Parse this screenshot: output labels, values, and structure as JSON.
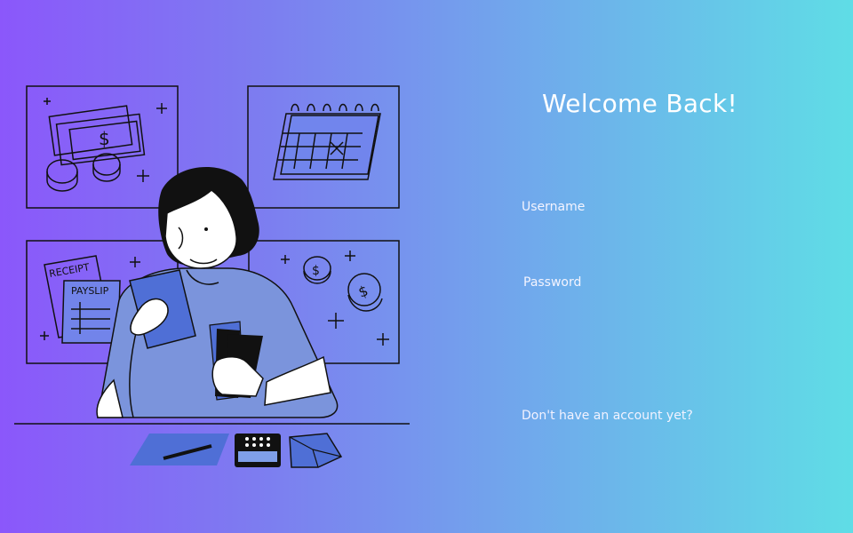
{
  "login": {
    "title": "Welcome Back!",
    "username_label": "Username",
    "username_value": "",
    "password_label": "Password",
    "password_value": "",
    "signup_link": "Don't have an account yet?"
  },
  "illustration": {
    "receipt_text": "RECEIPT",
    "payslip_text": "PAYSLIP",
    "money_symbol": "$"
  },
  "colors": {
    "gradient_start": "#8b57fb",
    "gradient_end": "#5fdde6",
    "text": "#ffffff",
    "accent_blue": "#4f6fd6"
  }
}
